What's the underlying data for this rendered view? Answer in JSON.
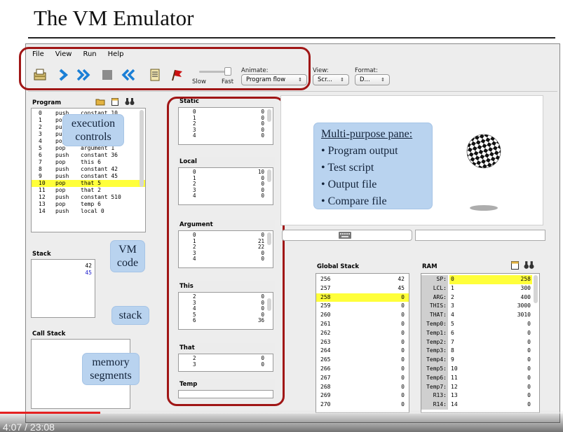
{
  "slide": {
    "title": "The VM Emulator"
  },
  "menu": [
    "File",
    "View",
    "Run",
    "Help"
  ],
  "toolbar": {
    "slow_label": "Slow",
    "fast_label": "Fast",
    "animate_label": "Animate:",
    "animate_value": "Program flow",
    "view_label": "View:",
    "view_value": "Scr...",
    "format_label": "Format:",
    "format_value": "D..."
  },
  "program": {
    "title": "Program",
    "rows": [
      {
        "n": "0",
        "cmd": "push",
        "arg": "constant 10"
      },
      {
        "n": "1",
        "cmd": "pop",
        "arg": ""
      },
      {
        "n": "2",
        "cmd": "push",
        "arg": ""
      },
      {
        "n": "3",
        "cmd": "push",
        "arg": ""
      },
      {
        "n": "4",
        "cmd": "pop",
        "arg": ""
      },
      {
        "n": "5",
        "cmd": "pop",
        "arg": "argument 1"
      },
      {
        "n": "6",
        "cmd": "push",
        "arg": "constant 36"
      },
      {
        "n": "7",
        "cmd": "pop",
        "arg": "this 6"
      },
      {
        "n": "8",
        "cmd": "push",
        "arg": "constant 42"
      },
      {
        "n": "9",
        "cmd": "push",
        "arg": "constant 45"
      },
      {
        "n": "10",
        "cmd": "pop",
        "arg": "that 5"
      },
      {
        "n": "11",
        "cmd": "pop",
        "arg": "that 2"
      },
      {
        "n": "12",
        "cmd": "push",
        "arg": "constant 510"
      },
      {
        "n": "13",
        "cmd": "pop",
        "arg": "temp 6"
      },
      {
        "n": "14",
        "cmd": "push",
        "arg": "local 0"
      }
    ],
    "highlight_index": 10
  },
  "stack": {
    "title": "Stack",
    "values": [
      "42",
      "45"
    ]
  },
  "call_stack": {
    "title": "Call Stack"
  },
  "segments": {
    "static": {
      "title": "Static",
      "rows": [
        [
          "0",
          "0"
        ],
        [
          "1",
          "0"
        ],
        [
          "2",
          "0"
        ],
        [
          "3",
          "0"
        ],
        [
          "4",
          "0"
        ]
      ]
    },
    "local": {
      "title": "Local",
      "rows": [
        [
          "0",
          "10"
        ],
        [
          "1",
          "0"
        ],
        [
          "2",
          "0"
        ],
        [
          "3",
          "0"
        ],
        [
          "4",
          "0"
        ]
      ]
    },
    "argument": {
      "title": "Argument",
      "rows": [
        [
          "0",
          "0"
        ],
        [
          "1",
          "21"
        ],
        [
          "2",
          "22"
        ],
        [
          "3",
          "0"
        ],
        [
          "4",
          "0"
        ]
      ]
    },
    "this": {
      "title": "This",
      "rows": [
        [
          "2",
          "0"
        ],
        [
          "3",
          "0"
        ],
        [
          "4",
          "0"
        ],
        [
          "5",
          "0"
        ],
        [
          "6",
          "36"
        ]
      ]
    },
    "that": {
      "title": "That",
      "rows": [
        [
          "2",
          "0"
        ],
        [
          "3",
          "0"
        ]
      ]
    },
    "temp": {
      "title": "Temp"
    }
  },
  "global_stack": {
    "title": "Global Stack",
    "rows": [
      [
        "256",
        "42"
      ],
      [
        "257",
        "45"
      ],
      [
        "258",
        "0"
      ],
      [
        "259",
        "0"
      ],
      [
        "260",
        "0"
      ],
      [
        "261",
        "0"
      ],
      [
        "262",
        "0"
      ],
      [
        "263",
        "0"
      ],
      [
        "264",
        "0"
      ],
      [
        "265",
        "0"
      ],
      [
        "266",
        "0"
      ],
      [
        "267",
        "0"
      ],
      [
        "268",
        "0"
      ],
      [
        "269",
        "0"
      ],
      [
        "270",
        "0"
      ]
    ],
    "highlight_index": 2
  },
  "ram": {
    "title": "RAM",
    "rows": [
      [
        "SP:",
        "0",
        "258"
      ],
      [
        "LCL:",
        "1",
        "300"
      ],
      [
        "ARG:",
        "2",
        "400"
      ],
      [
        "THIS:",
        "3",
        "3000"
      ],
      [
        "THAT:",
        "4",
        "3010"
      ],
      [
        "Temp0:",
        "5",
        "0"
      ],
      [
        "Temp1:",
        "6",
        "0"
      ],
      [
        "Temp2:",
        "7",
        "0"
      ],
      [
        "Temp3:",
        "8",
        "0"
      ],
      [
        "Temp4:",
        "9",
        "0"
      ],
      [
        "Temp5:",
        "10",
        "0"
      ],
      [
        "Temp6:",
        "11",
        "0"
      ],
      [
        "Temp7:",
        "12",
        "0"
      ],
      [
        "R13:",
        "13",
        "0"
      ],
      [
        "R14:",
        "14",
        "0"
      ]
    ],
    "highlight_index": 0
  },
  "callouts": {
    "execution": "execution controls",
    "vm_code": "VM code",
    "stack": "stack",
    "memory": "memory segments",
    "multi_title": "Multi-purpose pane:",
    "multi_items": [
      "Program output",
      "Test script",
      "Output file",
      "Compare file"
    ]
  },
  "video": {
    "time": "4:07  /  23:08",
    "progress": 0.178
  },
  "colors": {
    "highlight": "#ffff3a",
    "callout": "#b9d3ef",
    "red_outline": "#a01616",
    "toolbar_blue": "#1a7fd6"
  }
}
